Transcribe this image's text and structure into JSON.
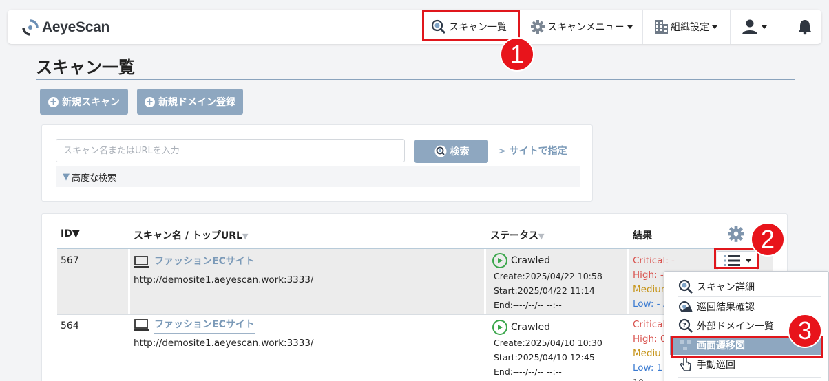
{
  "app": {
    "logo": "AeyeScan"
  },
  "nav": {
    "scan_list": "スキャン一覧",
    "scan_menu": "スキャンメニュー",
    "org_settings": "組織設定"
  },
  "callouts": [
    "1",
    "2",
    "3"
  ],
  "page": {
    "title": "スキャン一覧",
    "new_scan": "新規スキャン",
    "new_domain": "新規ドメイン登録"
  },
  "search": {
    "placeholder": "スキャン名またはURLを入力",
    "button": "検索",
    "site_link": "サイトで指定",
    "advanced": "高度な検索"
  },
  "table": {
    "headers": {
      "id": "ID▼",
      "name": "スキャン名 / トップURL",
      "status": "ステータス",
      "result": "結果"
    },
    "rows": [
      {
        "id": "567",
        "name": "ファッションECサイト",
        "url": "http://demosite1.aeyescan.work:3333/",
        "status": "Crawled",
        "create": "Create:2025/04/22 10:58",
        "start": "Start:2025/04/22 11:14",
        "end": "End:----/--/-- --:--",
        "critical": "Critical: -",
        "high": "High: -",
        "medium": "Medium",
        "low": "Low: - /"
      },
      {
        "id": "564",
        "name": "ファッションECサイト",
        "url": "http://demosite1.aeyescan.work:3333/",
        "status": "Crawled",
        "create": "Create:2025/04/10 10:30",
        "start": "Start:2025/04/10 12:45",
        "end": "End:----/--/-- --:--",
        "critical": "Critical",
        "high": "High: 0",
        "medium": "Mediu",
        "low": "Low: 1",
        "extra": "10"
      }
    ]
  },
  "menu": {
    "items": [
      "スキャン詳細",
      "巡回結果確認",
      "外部ドメイン一覧",
      "画面遷移図",
      "手動巡回"
    ]
  },
  "colors": {
    "accent": "#8ea7c0",
    "callout_red": "#e8141b",
    "link": "#7b9ab8",
    "crawled_green": "#3aa64b"
  }
}
